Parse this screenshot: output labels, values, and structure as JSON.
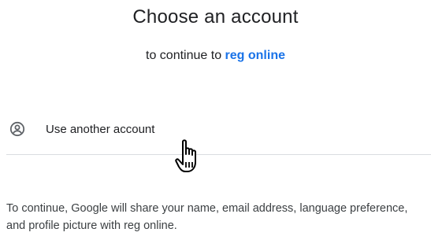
{
  "header": {
    "title": "Choose an account",
    "subtitle_prefix": "to continue to ",
    "app_name": "reg online"
  },
  "accounts": {
    "other_account_label": "Use another account",
    "other_account_icon": "account-circle-icon"
  },
  "notice": {
    "text": "To continue, Google will share your name, email address, language preference, and profile picture with reg online."
  },
  "colors": {
    "link_blue": "#1a73e8",
    "text": "#202124",
    "divider": "#dadce0"
  },
  "cursor": {
    "icon": "hand-pointer-cursor-icon"
  }
}
